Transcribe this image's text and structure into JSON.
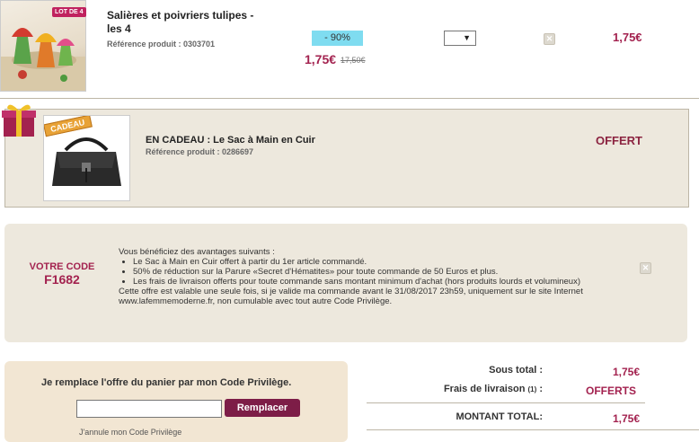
{
  "product": {
    "image_badge": "LOT DE 4",
    "title": "Salières et poivriers tulipes - les 4",
    "reference": "Référence produit : 0303701",
    "discount": "- 90%",
    "price": "1,75€",
    "old_price": "17,50€",
    "quantity": "",
    "total": "1,75€"
  },
  "gift": {
    "tag": "CADEAU",
    "title": "EN CADEAU : Le Sac à Main en Cuir",
    "reference": "Référence produit : 0286697",
    "status": "OFFERT"
  },
  "promo": {
    "label": "VOTRE CODE",
    "code": "F1682",
    "intro": "Vous bénéficiez des avantages suivants :",
    "items": [
      "Le Sac à Main en Cuir offert à partir du 1er article commandé.",
      "50% de réduction sur la Parure «Secret d'Hématites» pour toute commande de 50 Euros et plus.",
      "Les frais de livraison offerts pour toute commande sans montant minimum d'achat (hors produits lourds et volumineux)"
    ],
    "conditions": "Cette offre est valable une seule fois, si je valide ma commande avant le 31/08/2017 23h59, uniquement sur le site Internet www.lafemmemoderne.fr, non cumulable avec tout autre Code Privilège."
  },
  "replace": {
    "title": "Je remplace l'offre du panier par mon Code Privilège.",
    "input_value": "",
    "button": "Remplacer",
    "cancel": "J'annule mon Code Privilège"
  },
  "totals": {
    "subtotal_label": "Sous total :",
    "subtotal_value": "1,75€",
    "shipping_label": "Frais de livraison",
    "shipping_note": "(1)",
    "shipping_colon": ":",
    "shipping_value": "OFFERTS",
    "total_label": "MONTANT TOTAL:",
    "total_value": "1,75€"
  },
  "colors": {
    "price": "#a3224f",
    "discount_bg": "#7fdcf0",
    "panel_bg": "#ede8dd",
    "button_bg": "#7d1d47"
  },
  "icons": [
    "close-icon",
    "dropdown-arrow-icon",
    "gift-box-icon"
  ]
}
